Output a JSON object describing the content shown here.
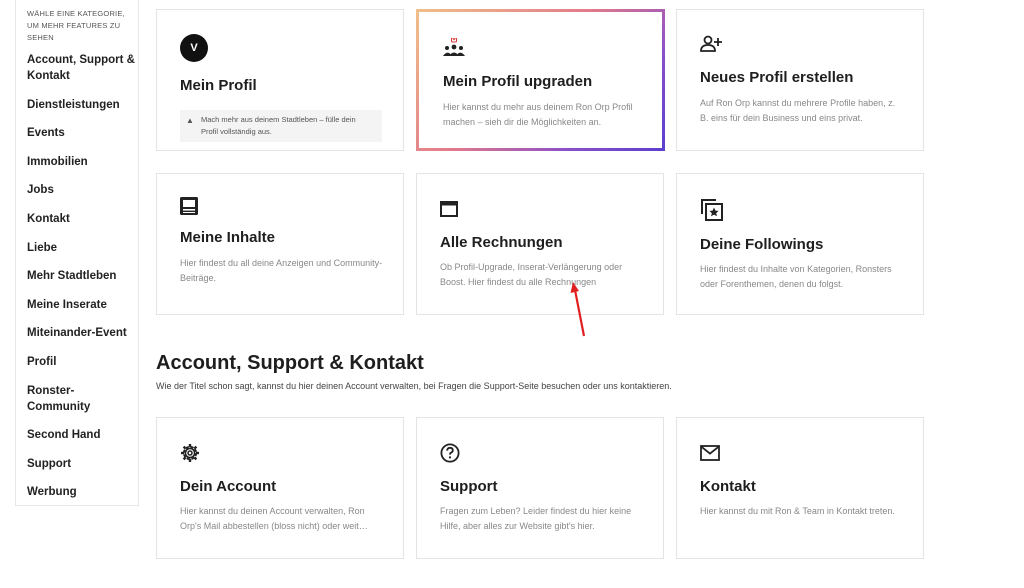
{
  "sidebar": {
    "hint": "Wähle eine Kategorie, um mehr Features zu sehen",
    "items": [
      "Account, Support & Kontakt",
      "Dienstleistungen",
      "Events",
      "Immobilien",
      "Jobs",
      "Kontakt",
      "Liebe",
      "Mehr Stadtleben",
      "Meine Inserate",
      "Miteinander-Event",
      "Profil",
      "Ronster-Community",
      "Second Hand",
      "Support",
      "Werbung"
    ]
  },
  "cards": {
    "profile": {
      "avatar_letter": "V",
      "title": "Mein Profil",
      "notice": "Mach mehr aus deinem Stadtleben – fülle dein Profil vollständig aus.",
      "warn_icon": "warning-icon"
    },
    "upgrade": {
      "icon": "people-upgrade-icon",
      "title": "Mein Profil upgraden",
      "desc": "Hier kannst du mehr aus deinem Ron Orp Profil machen – sieh dir die Möglichkeiten an."
    },
    "new_profile": {
      "icon": "add-person-icon",
      "title": "Neues Profil erstellen",
      "desc": "Auf Ron Orp kannst du mehrere Profile haben, z. B. eins für dein Business und eins privat."
    },
    "content": {
      "icon": "content-icon",
      "title": "Meine Inhalte",
      "desc": "Hier findest du all deine Anzeigen und Community-Beiträge."
    },
    "invoices": {
      "icon": "window-icon",
      "title": "Alle Rechnungen",
      "desc": "Ob Profil-Upgrade, Inserat-Verlängerung oder Boost. Hier findest du alle Rechnungen"
    },
    "followings": {
      "icon": "star-stack-icon",
      "title": "Deine Followings",
      "desc": "Hier findest du Inhalte von Kategorien, Ronsters oder Forenthemen, denen du folgst."
    },
    "account": {
      "icon": "gear-icon",
      "title": "Dein Account",
      "desc": "Hier kannst du deinen Account verwalten, Ron Orp's Mail abbestellen (bloss nicht) oder weit…"
    },
    "support": {
      "icon": "question-icon",
      "title": "Support",
      "desc": "Fragen zum Leben? Leider findest du hier keine Hilfe, aber alles zur Website gibt's hier."
    },
    "contact": {
      "icon": "mail-icon",
      "title": "Kontakt",
      "desc": "Hier kannst du mit Ron & Team in Kontakt treten."
    }
  },
  "section": {
    "title": "Account, Support & Kontakt",
    "subtitle": "Wie der Titel schon sagt, kannst du hier deinen Account verwalten, bei Fragen die Support-Seite besuchen oder uns kontaktieren."
  },
  "colors": {
    "annotation_arrow": "#e02020",
    "gradient_start": "#f0c08a",
    "gradient_end": "#5b3fd0"
  }
}
